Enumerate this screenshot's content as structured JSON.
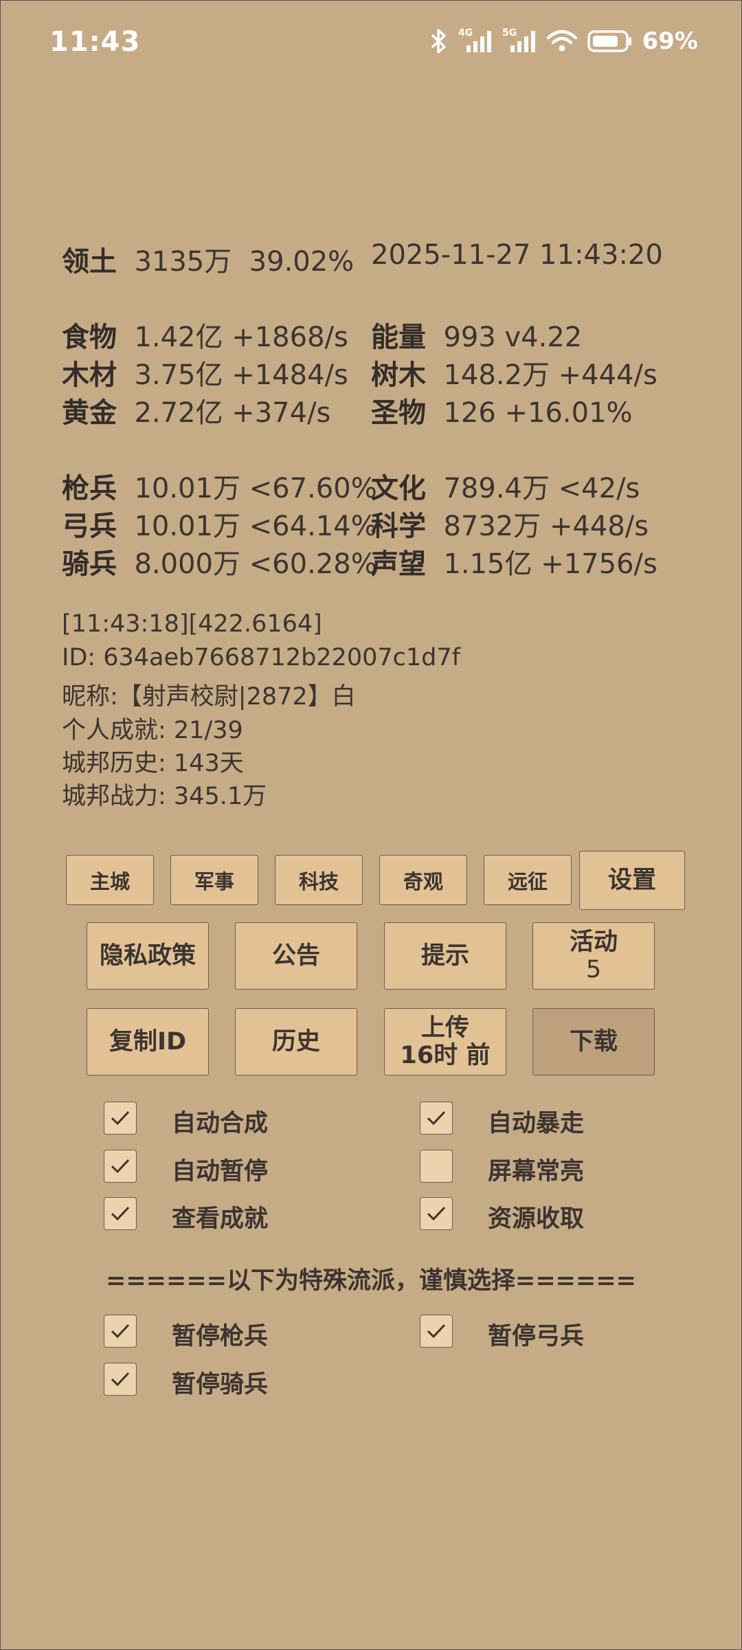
{
  "status_bar": {
    "time": "11:43",
    "network_4g": "4G",
    "network_5g": "5G",
    "battery": "69%"
  },
  "stats": {
    "territory": {
      "label": "领土",
      "value": "3135万",
      "pct": "39.02%"
    },
    "datetime": "2025-11-27 11:43:20",
    "food": {
      "label": "食物",
      "value": "1.42亿 +1868/s"
    },
    "energy": {
      "label": "能量",
      "value": "993  v4.22"
    },
    "wood": {
      "label": "木材",
      "value": "3.75亿 +1484/s"
    },
    "trees": {
      "label": "树木",
      "value": "148.2万 +444/s"
    },
    "gold": {
      "label": "黄金",
      "value": "2.72亿 +374/s"
    },
    "relics": {
      "label": "圣物",
      "value": "126 +16.01%"
    },
    "spearmen": {
      "label": "枪兵",
      "value": "10.01万 <67.60%"
    },
    "culture": {
      "label": "文化",
      "value": "789.4万 <42/s"
    },
    "archers": {
      "label": "弓兵",
      "value": "10.01万 <64.14%"
    },
    "science": {
      "label": "科学",
      "value": "8732万 +448/s"
    },
    "cavalry": {
      "label": "骑兵",
      "value": "8.000万 <60.28%"
    },
    "prestige": {
      "label": "声望",
      "value": "1.15亿 +1756/s"
    }
  },
  "info": {
    "timestamp": "[11:43:18][422.6164]",
    "id": "ID: 634aeb7668712b22007c1d7f",
    "nickname": "昵称:【射声校尉|2872】白",
    "achievements": "个人成就: 21/39",
    "history": "城邦历史: 143天",
    "power": "城邦战力: 345.1万"
  },
  "nav_tabs": {
    "main_city": "主城",
    "military": "军事",
    "tech": "科技",
    "wonders": "奇观",
    "expedition": "远征",
    "settings": "设置"
  },
  "actions": {
    "privacy": "隐私政策",
    "announcement": "公告",
    "tips": "提示",
    "events": "活动",
    "events_count": "5",
    "copy_id": "复制ID",
    "history": "历史",
    "upload": "上传",
    "upload_time": "16时 前",
    "download": "下载"
  },
  "options": {
    "auto_merge": {
      "label": "自动合成",
      "checked": true
    },
    "auto_rage": {
      "label": "自动暴走",
      "checked": true
    },
    "auto_pause": {
      "label": "自动暂停",
      "checked": true
    },
    "screen_on": {
      "label": "屏幕常亮",
      "checked": false
    },
    "view_achievements": {
      "label": "查看成就",
      "checked": true
    },
    "collect_resources": {
      "label": "资源收取",
      "checked": true
    }
  },
  "special_separator": "======以下为特殊流派，谨慎选择======",
  "special": {
    "pause_spearmen": {
      "label": "暂停枪兵",
      "checked": true
    },
    "pause_archers": {
      "label": "暂停弓兵",
      "checked": true
    },
    "pause_cavalry": {
      "label": "暂停骑兵",
      "checked": true
    }
  },
  "colors": {
    "background": "#c6ab87",
    "button": "#e2c195",
    "button_pressed": "#bea07d",
    "text": "#3b3530"
  }
}
